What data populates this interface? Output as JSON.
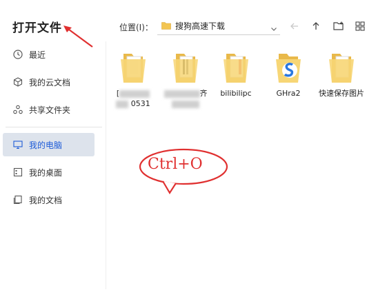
{
  "dialog": {
    "title": "打开文件"
  },
  "sidebar": {
    "items": [
      {
        "label": "最近",
        "icon": "clock-icon"
      },
      {
        "label": "我的云文档",
        "icon": "cube-icon"
      },
      {
        "label": "共享文件夹",
        "icon": "share-icon"
      },
      {
        "label": "我的电脑",
        "icon": "monitor-icon",
        "active": true
      },
      {
        "label": "我的桌面",
        "icon": "desktop-icon"
      },
      {
        "label": "我的文档",
        "icon": "documents-icon"
      }
    ]
  },
  "location": {
    "label": "位置(I)：",
    "value": "搜狗高速下载"
  },
  "files": [
    {
      "name_visible": "0531",
      "name_prefix": "["
    },
    {
      "name_visible": "齐",
      "name_prefix": ""
    },
    {
      "name": "bilibilipc"
    },
    {
      "name": "GHra2"
    },
    {
      "name": "快速保存图片"
    }
  ],
  "annotation": {
    "text": "Ctrl+O",
    "color": "#e03030"
  },
  "colors": {
    "active_bg": "#dde3ec",
    "active_text": "#1d5bd8",
    "folder": "#f3c552"
  }
}
